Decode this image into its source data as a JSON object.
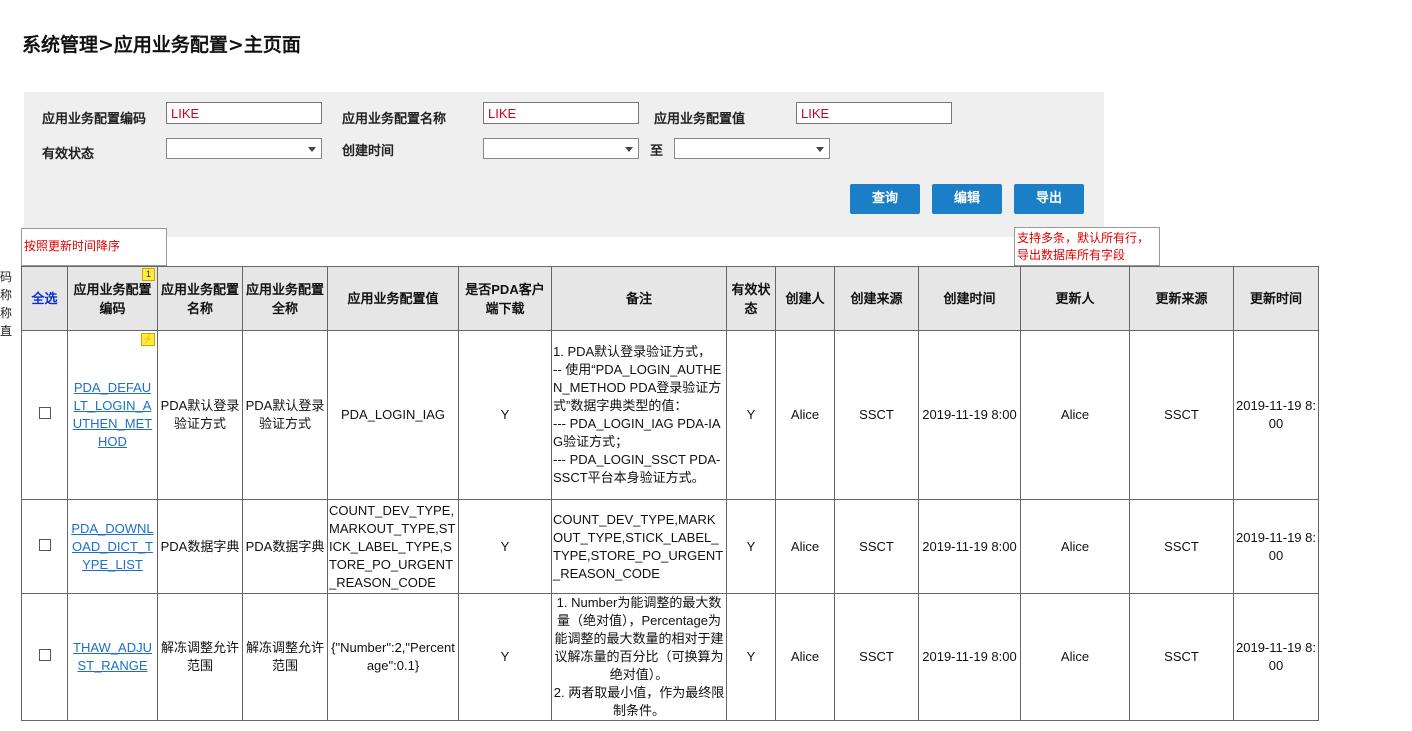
{
  "breadcrumb": "系统管理>应用业务配置>主页面",
  "side_fragment": [
    "码",
    "称",
    "称",
    "直"
  ],
  "filters": {
    "code_label": "应用业务配置编码",
    "code_value": "LIKE",
    "name_label": "应用业务配置名称",
    "name_value": "LIKE",
    "value_label": "应用业务配置值",
    "value_value": "LIKE",
    "status_label": "有效状态",
    "created_label": "创建时间",
    "to_label": "至"
  },
  "buttons": {
    "query": "查询",
    "edit": "编辑",
    "export": "导出"
  },
  "notes": {
    "sort": "按照更新时间降序",
    "export_line1": "支持多条，默认所有行，",
    "export_line2": "导出数据库所有字段"
  },
  "table": {
    "headers": {
      "select_all": "全选",
      "code": "应用业务配置编码",
      "name": "应用业务配置名称",
      "fullname": "应用业务配置全称",
      "value": "应用业务配置值",
      "pda": "是否PDA客户端下载",
      "remark": "备注",
      "status": "有效状态",
      "creator": "创建人",
      "create_source": "创建来源",
      "create_time": "创建时间",
      "updater": "更新人",
      "update_source": "更新来源",
      "update_time": "更新时间"
    },
    "code_badge": "1",
    "rows": [
      {
        "code": "PDA_DEFAULT_LOGIN_AUTHEN_METHOD",
        "name": "PDA默认登录验证方式",
        "fullname": "PDA默认登录验证方式",
        "value": "PDA_LOGIN_IAG",
        "pda": "Y",
        "remark": [
          "1. PDA默认登录验证方式，",
          "-- 使用“PDA_LOGIN_AUTHEN_METHOD PDA登录验证方式”数据字典类型的值：",
          "--- PDA_LOGIN_IAG PDA-IAG验证方式；",
          "--- PDA_LOGIN_SSCT PDA-SSCT平台本身验证方式。"
        ],
        "status": "Y",
        "creator": "Alice",
        "create_source": "SSCT",
        "create_time": "2019-11-19 8:00",
        "updater": "Alice",
        "update_source": "SSCT",
        "update_time": "2019-11-19 8:00"
      },
      {
        "code": "PDA_DOWNLOAD_DICT_TYPE_LIST",
        "name": "PDA数据字典",
        "fullname": "PDA数据字典",
        "value": "COUNT_DEV_TYPE,MARKOUT_TYPE,STICK_LABEL_TYPE,STORE_PO_URGENT_REASON_CODE",
        "pda": "Y",
        "remark": [
          "COUNT_DEV_TYPE,MARKOUT_TYPE,STICK_LABEL_TYPE,STORE_PO_URGENT_REASON_CODE"
        ],
        "status": "Y",
        "creator": "Alice",
        "create_source": "SSCT",
        "create_time": "2019-11-19 8:00",
        "updater": "Alice",
        "update_source": "SSCT",
        "update_time": "2019-11-19 8:00"
      },
      {
        "code": "THAW_ADJUST_RANGE",
        "name": "解冻调整允许范围",
        "fullname": "解冻调整允许范围",
        "value": "{\"Number\":2,\"Percentage\":0.1}",
        "pda": "Y",
        "remark": [
          "1. Number为能调整的最大数量（绝对值），Percentage为能调整的最大数量的相对于建议解冻量的百分比（可换算为绝对值）。",
          "2. 两者取最小值，作为最终限制条件。"
        ],
        "status": "Y",
        "creator": "Alice",
        "create_source": "SSCT",
        "create_time": "2019-11-19 8:00",
        "updater": "Alice",
        "update_source": "SSCT",
        "update_time": "2019-11-19 8:00"
      }
    ]
  }
}
